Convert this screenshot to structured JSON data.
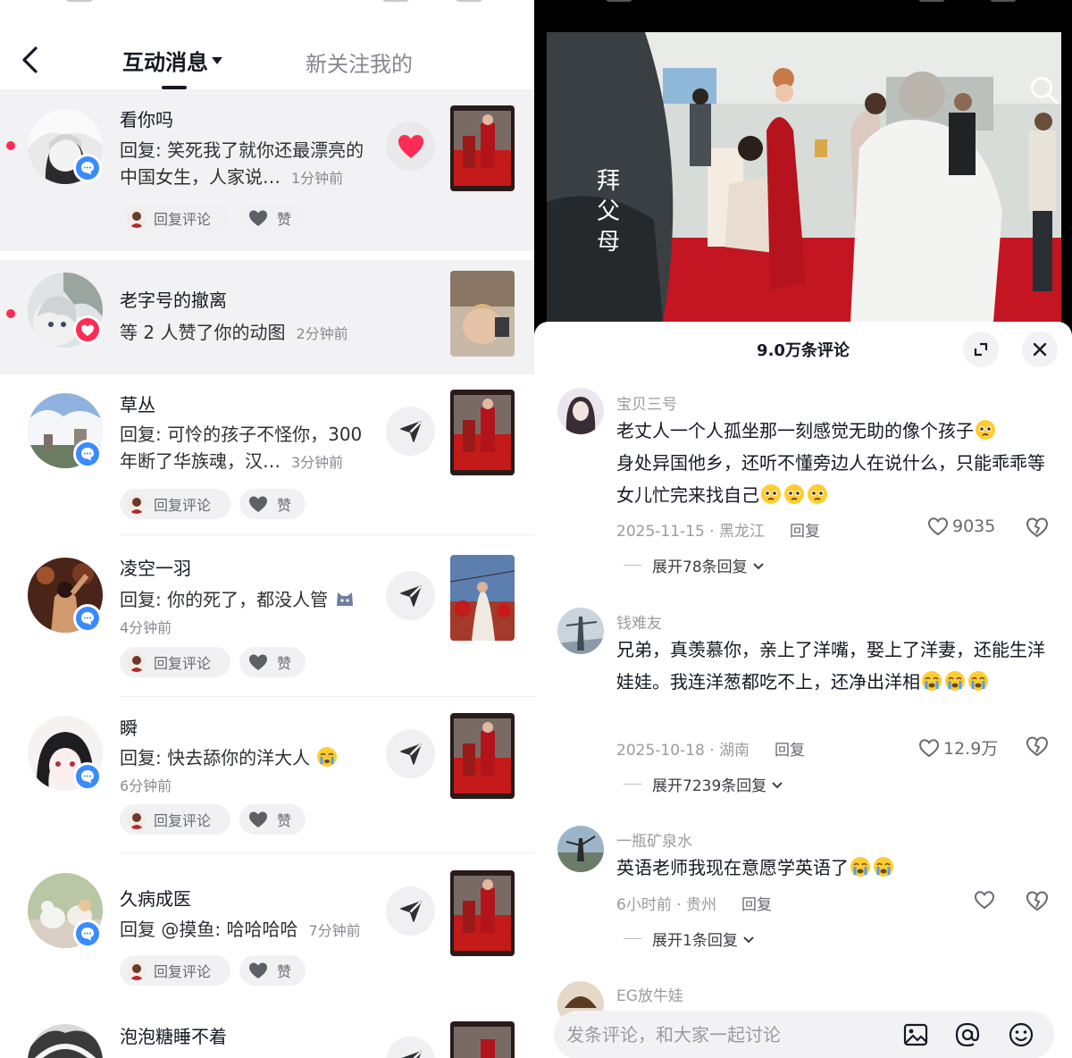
{
  "left": {
    "header": {
      "active_tab": "互动消息",
      "inactive_tab": "新关注我的"
    },
    "actions": {
      "reply_label": "回复评论",
      "like_label": "赞"
    },
    "items": [
      {
        "name": "看你吗",
        "message": "回复: 笑死我了就你还最漂亮的中国女生，人家说…",
        "time": "1分钟前",
        "unread": true,
        "action": "heart-liked"
      },
      {
        "name": "老字号的撤离",
        "message": "等 2 人赞了你的动图",
        "time": "2分钟前",
        "unread": true,
        "action": "none"
      },
      {
        "name": "草丛",
        "message": "回复: 可怜的孩子不怪你，300年断了华族魂，汉…",
        "time": "3分钟前",
        "unread": false,
        "action": "send"
      },
      {
        "name": "凌空一羽",
        "message": "回复: 你的死了，都没人管",
        "time": "4分钟前",
        "unread": false,
        "action": "send"
      },
      {
        "name": "瞬",
        "message": "回复: 快去舔你的洋大人",
        "time": "6分钟前",
        "unread": false,
        "action": "send"
      },
      {
        "name": "久病成医",
        "message": "回复 @摸鱼: 哈哈哈哈",
        "time": "7分钟前",
        "unread": false,
        "action": "send"
      },
      {
        "name": "泡泡糖睡不着",
        "message": "",
        "time": "",
        "unread": false,
        "action": "send"
      }
    ]
  },
  "right": {
    "video": {
      "caption": "拜父母"
    },
    "comments_sheet": {
      "title": "9.0万条评论",
      "comments": [
        {
          "user": "宝贝三号",
          "text": "老丈人一个人孤坐那一刻感觉无助的像个孩子",
          "text2": "身处异国他乡，还听不懂旁边人在说什么，只能乖乖等女儿忙完来找自己",
          "date": "2025-11-15",
          "region": "黑龙江",
          "reply_label": "回复",
          "likes": "9035",
          "expand": "展开78条回复"
        },
        {
          "user": "钱难友",
          "text": "兄弟，真羡慕你，亲上了洋嘴，娶上了洋妻，还能生洋娃娃。我连洋葱都吃不上，还净出洋相",
          "date": "2025-10-18",
          "region": "湖南",
          "reply_label": "回复",
          "likes": "12.9万",
          "expand": "展开7239条回复"
        },
        {
          "user": "一瓶矿泉水",
          "text": "英语老师我现在意愿学英语了",
          "date": "6小时前",
          "region": "贵州",
          "reply_label": "回复",
          "likes": "",
          "expand": "展开1条回复"
        },
        {
          "user": "EG放牛娃"
        }
      ],
      "input_placeholder": "发条评论，和大家一起讨论"
    }
  },
  "colors": {
    "accent_red": "#fe2c55",
    "badge_blue": "#3a8bff",
    "text_primary": "#161823",
    "text_secondary": "#8a8b91"
  }
}
